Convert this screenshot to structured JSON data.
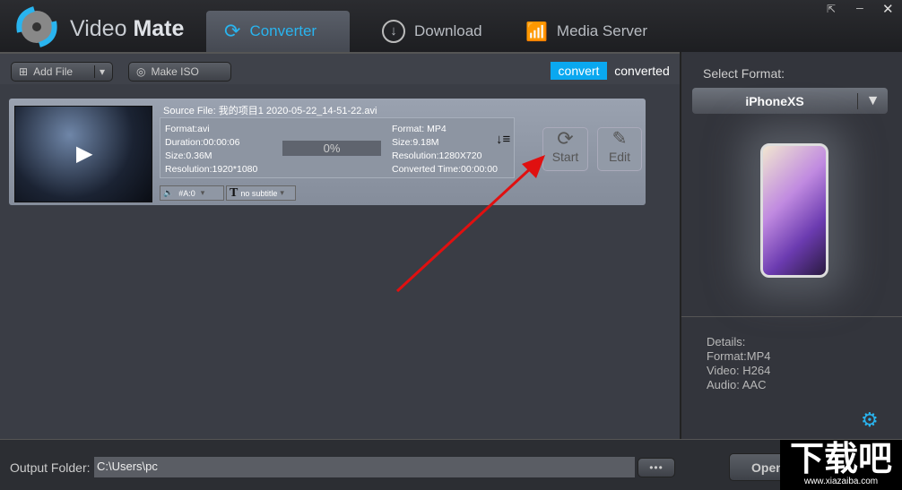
{
  "app": {
    "title_light": "Video",
    "title_bold": "Mate"
  },
  "tabs": [
    {
      "label": "Converter",
      "active": true
    },
    {
      "label": "Download"
    },
    {
      "label": "Media Server"
    }
  ],
  "toolbar": {
    "add_file": "Add File",
    "make_iso": "Make ISO",
    "convert": "convert",
    "converted": "converted"
  },
  "item": {
    "source_file": "Source File: 我的项目1 2020-05-22_14-51-22.avi",
    "src": [
      "Format:avi",
      "Duration:00:00:06",
      "Size:0.36M",
      "Resolution:1920*1080"
    ],
    "progress": "0%",
    "dst": [
      "Format: MP4",
      "Size:9.18M",
      "Resolution:1280X720",
      "Converted Time:00:00:00"
    ],
    "audio": "#A:0",
    "subtitle": "no subtitle",
    "start": "Start",
    "edit": "Edit"
  },
  "right": {
    "select_format": "Select Format:",
    "format": "iPhoneXS",
    "details": [
      "Details:",
      "Format:MP4",
      "Video: H264",
      "Audio: AAC"
    ]
  },
  "bottom": {
    "output_label": "Output Folder:",
    "output_value": "C:\\Users\\pc",
    "browse": "•••",
    "open": "Open"
  },
  "watermark": {
    "text": "下载吧",
    "url": "www.xiazaiba.com"
  },
  "colors": {
    "accent": "#29b4ef",
    "arrow": "#e01010"
  }
}
